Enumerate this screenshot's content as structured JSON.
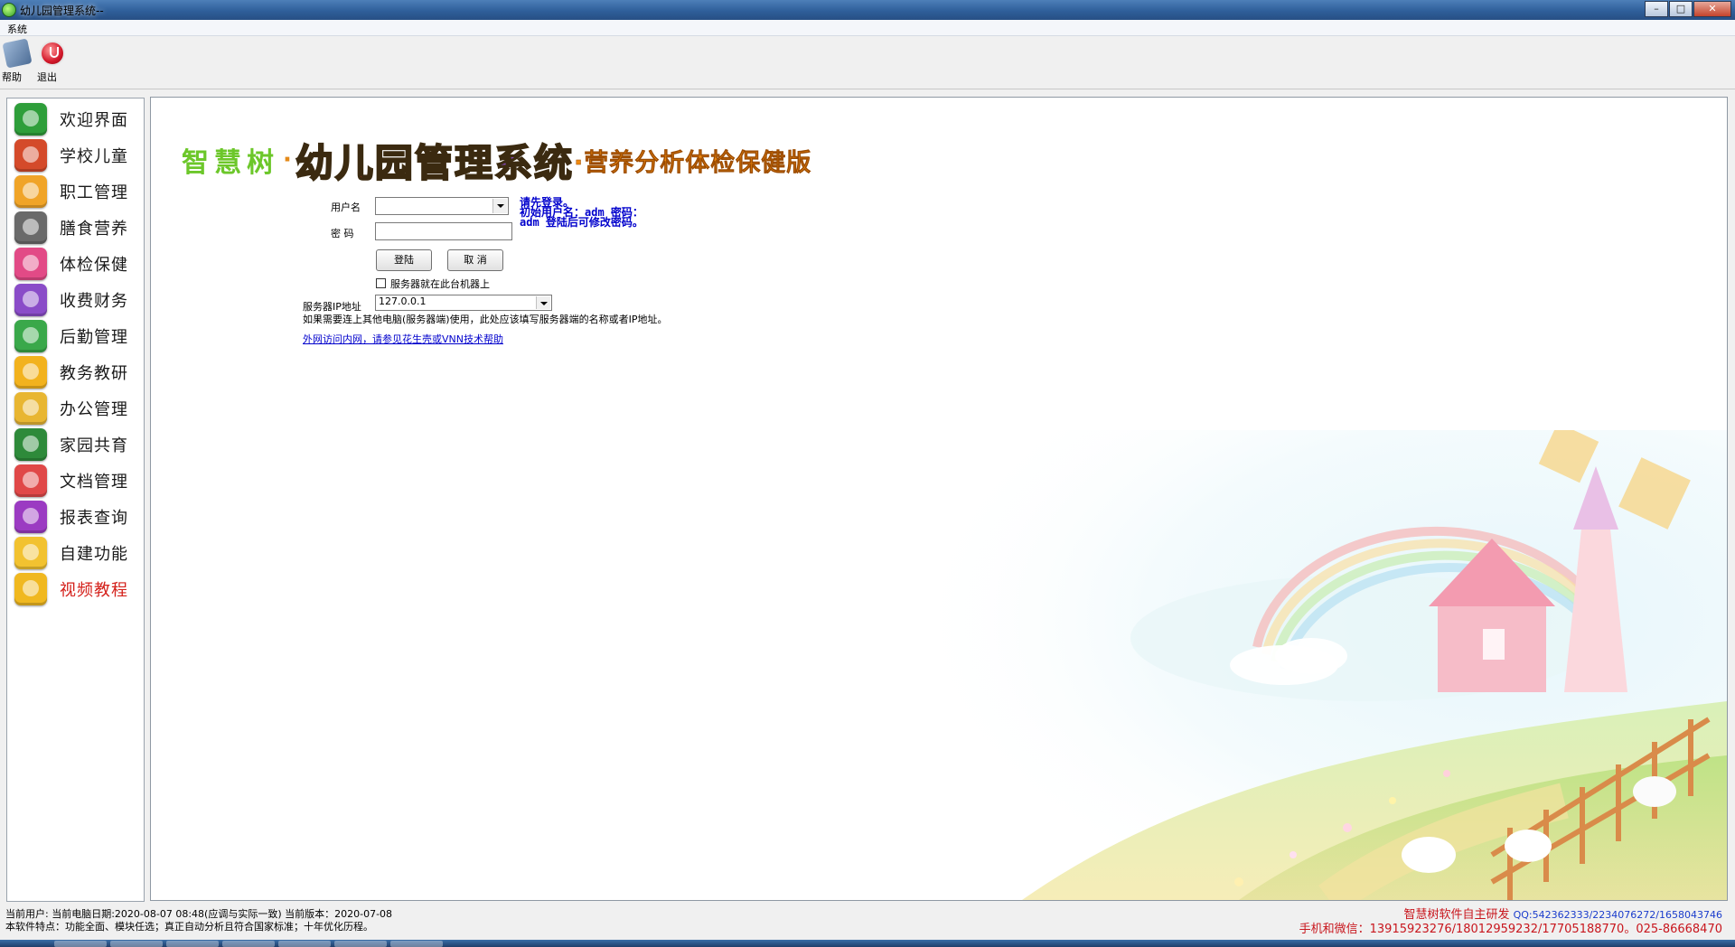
{
  "window": {
    "title": "幼儿园管理系统--"
  },
  "menu": {
    "system": "系统"
  },
  "toolbar": {
    "help": "帮助",
    "exit": "退出"
  },
  "sidebar": {
    "items": [
      {
        "label": "欢迎界面",
        "color": "#2e9e3a"
      },
      {
        "label": "学校儿童",
        "color": "#d44a2a"
      },
      {
        "label": "职工管理",
        "color": "#f0a428"
      },
      {
        "label": "膳食营养",
        "color": "#6a6a6a"
      },
      {
        "label": "体检保健",
        "color": "#e24a86"
      },
      {
        "label": "收费财务",
        "color": "#8a4cc8"
      },
      {
        "label": "后勤管理",
        "color": "#3aa84a"
      },
      {
        "label": "教务教研",
        "color": "#f2b21e"
      },
      {
        "label": "办公管理",
        "color": "#e8b632"
      },
      {
        "label": "家园共育",
        "color": "#2e8a3a"
      },
      {
        "label": "文档管理",
        "color": "#e04848"
      },
      {
        "label": "报表查询",
        "color": "#9b3bc2"
      },
      {
        "label": "自建功能",
        "color": "#f2c230"
      },
      {
        "label": "视频教程",
        "color": "#f0b820"
      }
    ]
  },
  "logo": {
    "part1": "智慧树",
    "dot": "·",
    "part2": "幼儿园管理系统",
    "part3": "·营养分析体检保健版"
  },
  "login": {
    "username_label": "用户名",
    "username_value": "",
    "password_label": "密 码",
    "hint_line1": "请先登录。",
    "hint_line2": "初始用户名：adm 密码：",
    "hint_line3": "adm 登陆后可修改密码。",
    "login_button": "登陆",
    "cancel_button": "取 消",
    "server_local_label": "服务器就在此台机器上",
    "server_ip_label": "服务器IP地址",
    "server_ip_value": "127.0.0.1",
    "server_note": "如果需要连上其他电脑(服务器端)使用，此处应该填写服务器端的名称或者IP地址。",
    "remote_link": "外网访问内网，请参见花生壳或VNN技术帮助"
  },
  "status": {
    "line1": "当前用户: 当前电脑日期:2020-08-07 08:48(应调与实际一致) 当前版本：2020-07-08",
    "line2": "本软件特点：功能全面、模块任选；真正自动分析且符合国家标准；十年优化历程。",
    "right1_red": "智慧树软件自主研发",
    "right1_qq": "QQ:542362333/2234076272/1658043746",
    "right2": "手机和微信：13915923276/18012959232/17705188770。025-86668470"
  }
}
